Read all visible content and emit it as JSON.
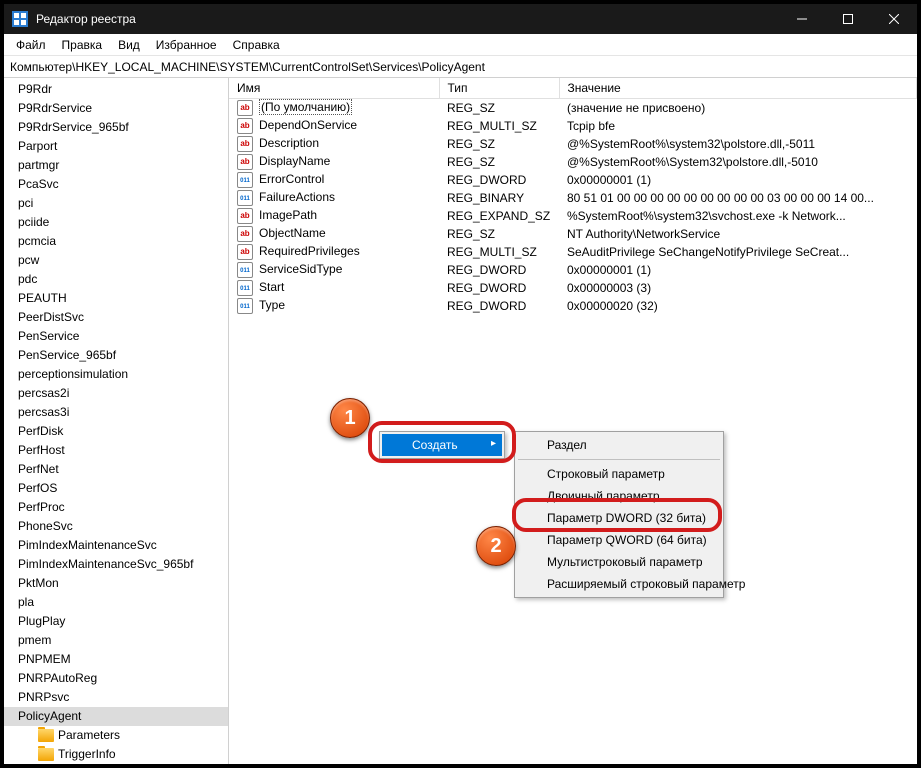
{
  "title": "Редактор реестра",
  "menu": [
    "Файл",
    "Правка",
    "Вид",
    "Избранное",
    "Справка"
  ],
  "address": "Компьютер\\HKEY_LOCAL_MACHINE\\SYSTEM\\CurrentControlSet\\Services\\PolicyAgent",
  "tree": [
    {
      "label": "P9Rdr"
    },
    {
      "label": "P9RdrService"
    },
    {
      "label": "P9RdrService_965bf"
    },
    {
      "label": "Parport"
    },
    {
      "label": "partmgr"
    },
    {
      "label": "PcaSvc"
    },
    {
      "label": "pci"
    },
    {
      "label": "pciide"
    },
    {
      "label": "pcmcia"
    },
    {
      "label": "pcw"
    },
    {
      "label": "pdc"
    },
    {
      "label": "PEAUTH"
    },
    {
      "label": "PeerDistSvc"
    },
    {
      "label": "PenService"
    },
    {
      "label": "PenService_965bf"
    },
    {
      "label": "perceptionsimulation"
    },
    {
      "label": "percsas2i"
    },
    {
      "label": "percsas3i"
    },
    {
      "label": "PerfDisk"
    },
    {
      "label": "PerfHost"
    },
    {
      "label": "PerfNet"
    },
    {
      "label": "PerfOS"
    },
    {
      "label": "PerfProc"
    },
    {
      "label": "PhoneSvc"
    },
    {
      "label": "PimIndexMaintenanceSvc"
    },
    {
      "label": "PimIndexMaintenanceSvc_965bf"
    },
    {
      "label": "PktMon"
    },
    {
      "label": "pla"
    },
    {
      "label": "PlugPlay"
    },
    {
      "label": "pmem"
    },
    {
      "label": "PNPMEM"
    },
    {
      "label": "PNRPAutoReg"
    },
    {
      "label": "PNRPsvc"
    },
    {
      "label": "PolicyAgent",
      "selected": true
    },
    {
      "label": "Parameters",
      "folder": true,
      "child": true
    },
    {
      "label": "TriggerInfo",
      "folder": true,
      "child": true
    }
  ],
  "columns": {
    "name": "Имя",
    "type": "Тип",
    "value": "Значение"
  },
  "rows": [
    {
      "icon": "ab",
      "name": "(По умолчанию)",
      "dotted": true,
      "type": "REG_SZ",
      "value": "(значение не присвоено)"
    },
    {
      "icon": "ab",
      "name": "DependOnService",
      "type": "REG_MULTI_SZ",
      "value": "Tcpip bfe"
    },
    {
      "icon": "ab",
      "name": "Description",
      "type": "REG_SZ",
      "value": "@%SystemRoot%\\system32\\polstore.dll,-5011"
    },
    {
      "icon": "ab",
      "name": "DisplayName",
      "type": "REG_SZ",
      "value": "@%SystemRoot%\\System32\\polstore.dll,-5010"
    },
    {
      "icon": "nn",
      "name": "ErrorControl",
      "type": "REG_DWORD",
      "value": "0x00000001 (1)"
    },
    {
      "icon": "nn",
      "name": "FailureActions",
      "type": "REG_BINARY",
      "value": "80 51 01 00 00 00 00 00 00 00 00 00 03 00 00 00 14 00..."
    },
    {
      "icon": "ab",
      "name": "ImagePath",
      "type": "REG_EXPAND_SZ",
      "value": "%SystemRoot%\\system32\\svchost.exe -k Network..."
    },
    {
      "icon": "ab",
      "name": "ObjectName",
      "type": "REG_SZ",
      "value": "NT Authority\\NetworkService"
    },
    {
      "icon": "ab",
      "name": "RequiredPrivileges",
      "type": "REG_MULTI_SZ",
      "value": "SeAuditPrivilege SeChangeNotifyPrivilege SeCreat..."
    },
    {
      "icon": "nn",
      "name": "ServiceSidType",
      "type": "REG_DWORD",
      "value": "0x00000001 (1)"
    },
    {
      "icon": "nn",
      "name": "Start",
      "type": "REG_DWORD",
      "value": "0x00000003 (3)"
    },
    {
      "icon": "nn",
      "name": "Type",
      "type": "REG_DWORD",
      "value": "0x00000020 (32)"
    }
  ],
  "context_main": {
    "create": "Создать"
  },
  "context_sub": {
    "section": "Раздел",
    "string": "Строковый параметр",
    "binary": "Двоичный параметр",
    "dword": "Параметр DWORD (32 бита)",
    "qword": "Параметр QWORD (64 бита)",
    "multistr": "Мультистроковый параметр",
    "expand": "Расширяемый строковый параметр"
  },
  "badges": {
    "one": "1",
    "two": "2"
  }
}
